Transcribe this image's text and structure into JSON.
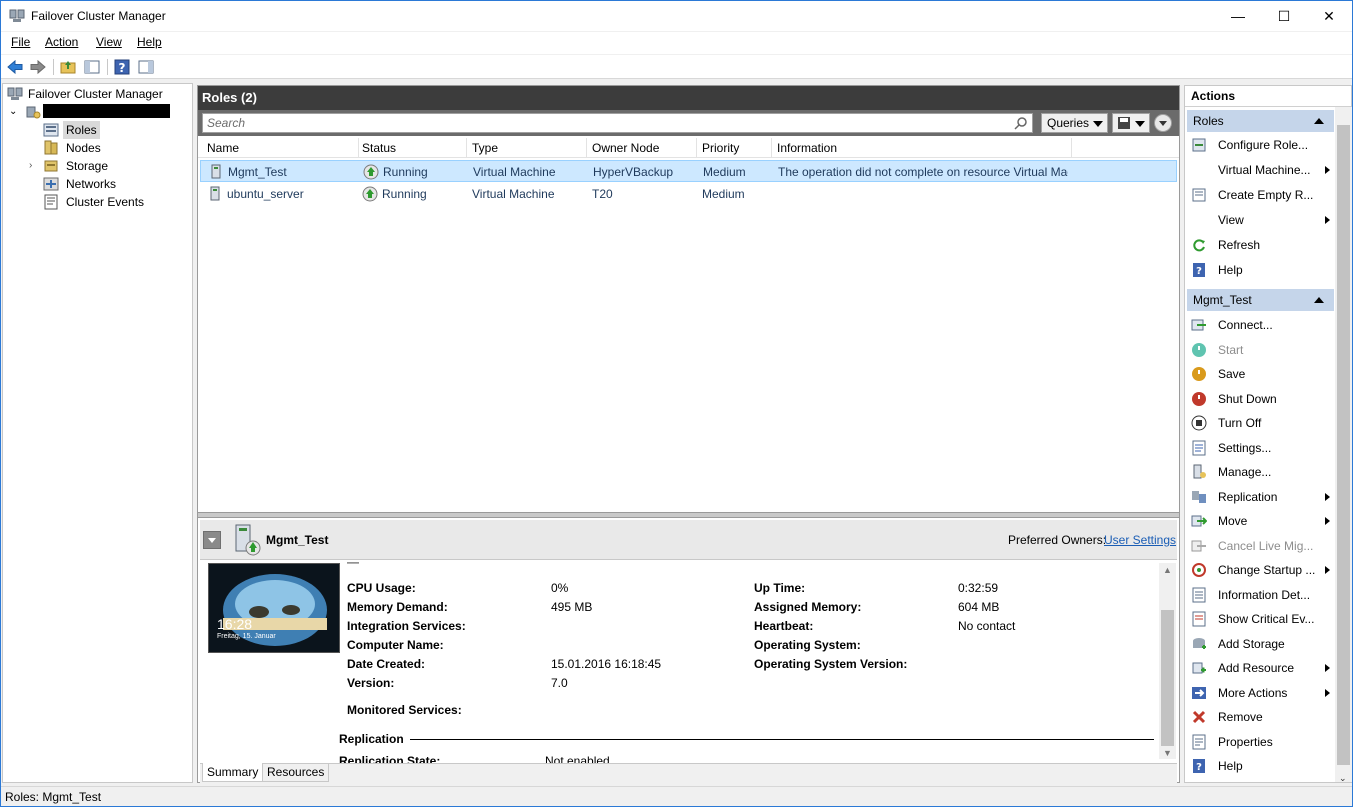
{
  "window": {
    "title": "Failover Cluster Manager",
    "controls": {
      "minimize": "—",
      "maximize": "☐",
      "close": "✕"
    }
  },
  "menu": {
    "file": "File",
    "action": "Action",
    "view": "View",
    "help": "Help"
  },
  "toolbar": {
    "icons": [
      "back-icon",
      "forward-icon",
      "up-folder-icon",
      "show-hide-tree-icon",
      "help-icon",
      "show-hide-action-pane-icon"
    ]
  },
  "tree": {
    "root": "Failover Cluster Manager",
    "items": [
      {
        "label": "Roles",
        "icon": "roles-icon"
      },
      {
        "label": "Nodes",
        "icon": "nodes-icon"
      },
      {
        "label": "Storage",
        "icon": "storage-icon"
      },
      {
        "label": "Networks",
        "icon": "networks-icon"
      },
      {
        "label": "Cluster Events",
        "icon": "cluster-events-icon"
      }
    ]
  },
  "roles": {
    "header": "Roles (2)",
    "search_placeholder": "Search",
    "queries_label": "Queries",
    "columns": [
      "Name",
      "Status",
      "Type",
      "Owner Node",
      "Priority",
      "Information"
    ],
    "rows": [
      {
        "name": "Mgmt_Test",
        "status": "Running",
        "type": "Virtual Machine",
        "owner": "HyperVBackup",
        "priority": "Medium",
        "info": "The operation did not complete on resource Virtual Machine"
      },
      {
        "name": "ubuntu_server",
        "status": "Running",
        "type": "Virtual Machine",
        "owner": "T20",
        "priority": "Medium",
        "info": ""
      }
    ]
  },
  "detail": {
    "title": "Mgmt_Test",
    "preferred_owners_label": "Preferred Owners:",
    "preferred_owners_link": "User Settings",
    "thumb_time": "16:28",
    "thumb_date": "Freitag, 15. Januar",
    "left": [
      {
        "label": "CPU Usage:",
        "value": "0%"
      },
      {
        "label": "Memory Demand:",
        "value": "495 MB"
      },
      {
        "label": "Integration Services:",
        "value": ""
      },
      {
        "label": "Computer Name:",
        "value": ""
      },
      {
        "label": "Date Created:",
        "value": "15.01.2016 16:18:45"
      },
      {
        "label": "Version:",
        "value": "7.0"
      }
    ],
    "right": [
      {
        "label": "Up Time:",
        "value": "0:32:59"
      },
      {
        "label": "Assigned Memory:",
        "value": "604 MB"
      },
      {
        "label": "Heartbeat:",
        "value": "No contact"
      },
      {
        "label": "Operating System:",
        "value": ""
      },
      {
        "label": "Operating System Version:",
        "value": ""
      }
    ],
    "monitored_services": "Monitored Services:",
    "replication_heading": "Replication",
    "replication_state_label": "Replication State:",
    "replication_state_value": "Not enabled",
    "tabs": [
      "Summary",
      "Resources"
    ]
  },
  "actions": {
    "header": "Actions",
    "roles_section": "Roles",
    "roles_items": [
      {
        "label": "Configure Role...",
        "icon": "configure-role-icon",
        "submenu": false,
        "disabled": false
      },
      {
        "label": "Virtual Machine...",
        "icon": "",
        "submenu": true,
        "disabled": false
      },
      {
        "label": "Create Empty R...",
        "icon": "create-empty-role-icon",
        "submenu": false,
        "disabled": false
      },
      {
        "label": "View",
        "icon": "",
        "submenu": true,
        "disabled": false
      },
      {
        "label": "Refresh",
        "icon": "refresh-icon",
        "submenu": false,
        "disabled": false
      },
      {
        "label": "Help",
        "icon": "help-icon",
        "submenu": false,
        "disabled": false
      }
    ],
    "vm_section": "Mgmt_Test",
    "vm_items": [
      {
        "label": "Connect...",
        "icon": "connect-icon",
        "submenu": false,
        "disabled": false
      },
      {
        "label": "Start",
        "icon": "start-icon",
        "submenu": false,
        "disabled": true
      },
      {
        "label": "Save",
        "icon": "save-icon",
        "submenu": false,
        "disabled": false
      },
      {
        "label": "Shut Down",
        "icon": "shut-down-icon",
        "submenu": false,
        "disabled": false
      },
      {
        "label": "Turn Off",
        "icon": "turn-off-icon",
        "submenu": false,
        "disabled": false
      },
      {
        "label": "Settings...",
        "icon": "settings-icon",
        "submenu": false,
        "disabled": false
      },
      {
        "label": "Manage...",
        "icon": "manage-icon",
        "submenu": false,
        "disabled": false
      },
      {
        "label": "Replication",
        "icon": "replication-icon",
        "submenu": true,
        "disabled": false
      },
      {
        "label": "Move",
        "icon": "move-icon",
        "submenu": true,
        "disabled": false
      },
      {
        "label": "Cancel Live Mig...",
        "icon": "cancel-live-migration-icon",
        "submenu": false,
        "disabled": true
      },
      {
        "label": "Change Startup ...",
        "icon": "change-startup-icon",
        "submenu": true,
        "disabled": false
      },
      {
        "label": "Information Det...",
        "icon": "information-details-icon",
        "submenu": false,
        "disabled": false
      },
      {
        "label": "Show Critical Ev...",
        "icon": "show-critical-events-icon",
        "submenu": false,
        "disabled": false
      },
      {
        "label": "Add Storage",
        "icon": "add-storage-icon",
        "submenu": false,
        "disabled": false
      },
      {
        "label": "Add Resource",
        "icon": "add-resource-icon",
        "submenu": true,
        "disabled": false
      },
      {
        "label": "More Actions",
        "icon": "more-actions-icon",
        "submenu": true,
        "disabled": false
      },
      {
        "label": "Remove",
        "icon": "remove-icon",
        "submenu": false,
        "disabled": false
      },
      {
        "label": "Properties",
        "icon": "properties-icon",
        "submenu": false,
        "disabled": false
      },
      {
        "label": "Help",
        "icon": "help-icon",
        "submenu": false,
        "disabled": false
      }
    ]
  },
  "statusbar": {
    "text": "Roles:  Mgmt_Test"
  },
  "colors": {
    "accent": "#2b79d6",
    "selection": "#cde8ff",
    "section": "#c5d5ea",
    "header_dark": "#3c3c3c",
    "link": "#1a5db5"
  }
}
